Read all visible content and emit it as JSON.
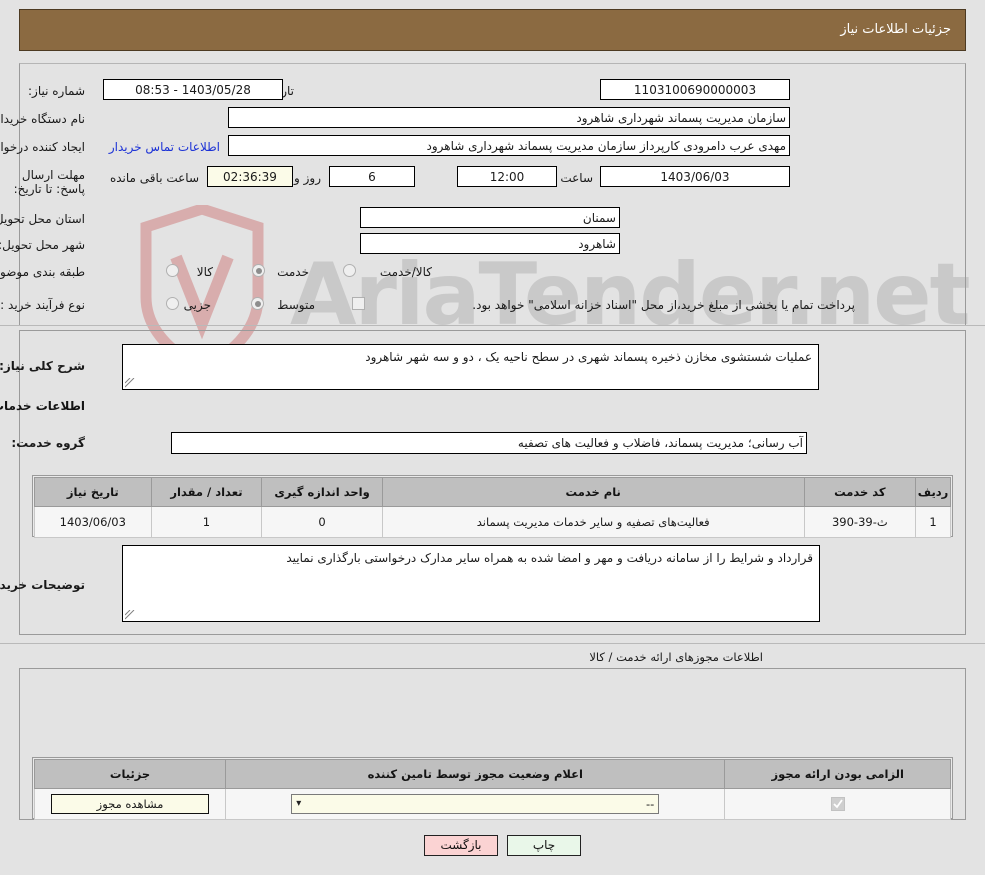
{
  "header": {
    "title": "جزئیات اطلاعات نیاز"
  },
  "watermark": {
    "text": "AriaTender.net"
  },
  "form": {
    "need_number_label": "شماره نیاز:",
    "need_number_value": "1103100690000003",
    "announce_label": "تاریخ و ساعت اعلان عمومی:",
    "announce_value": "1403/05/28 - 08:53",
    "buyer_org_label": "نام دستگاه خریدار:",
    "buyer_org_value": "سازمان مدیریت پسماند شهرداری شاهرود",
    "creator_label": "ایجاد کننده درخواست:",
    "creator_value": "مهدی عرب دامرودی کارپرداز سازمان مدیریت پسماند شهرداری شاهرود",
    "contact_link": "اطلاعات تماس خریدار",
    "deadline_label": "مهلت ارسال پاسخ: تا تاریخ:",
    "deadline_date": "1403/06/03",
    "hour_label": "ساعت",
    "hour_value": "12:00",
    "days_value": "6",
    "days_label": "روز و",
    "countdown_value": "02:36:39",
    "countdown_label": "ساعت باقی مانده",
    "province_label": "استان محل تحویل:",
    "province_value": "سمنان",
    "city_label": "شهر محل تحویل:",
    "city_value": "شاهرود",
    "category_label": "طبقه بندی موضوعی:",
    "category_options": [
      "کالا",
      "خدمت",
      "کالا/خدمت"
    ],
    "category_selected": "خدمت",
    "process_label": "نوع فرآیند خرید :",
    "process_options": [
      "جزیی",
      "متوسط"
    ],
    "process_selected": "متوسط",
    "treasury_note": "پرداخت تمام یا بخشی از مبلغ خرید،از محل \"اسناد خزانه اسلامی\" خواهد بود.",
    "treasury_checked": false
  },
  "description": {
    "need_summary_label": "شرح کلی نیاز:",
    "need_summary_value": "عملیات شستشوی مخازن ذخیره پسماند شهری در سطح ناحیه یک ، دو و سه شهر شاهرود",
    "services_heading": "اطلاعات خدمات مورد نیاز",
    "service_group_label": "گروه خدمت:",
    "service_group_value": "آب رسانی؛ مدیریت پسماند، فاضلاب و فعالیت های تصفیه",
    "buyer_notes_label": "توضیحات خریدار:",
    "buyer_notes_value": "قرارداد و شرایط را از سامانه دریافت و مهر و امضا شده به همراه سایر مدارک درخواستی بارگذاری نمایید"
  },
  "items_table": {
    "headers": [
      "ردیف",
      "کد خدمت",
      "نام خدمت",
      "واحد اندازه گیری",
      "تعداد / مقدار",
      "تاریخ نیاز"
    ],
    "rows": [
      [
        "1",
        "ث-39-390",
        "فعالیت‌های تصفیه و سایر خدمات مدیریت پسماند",
        "0",
        "1",
        "1403/06/03"
      ]
    ]
  },
  "permits": {
    "section_label": "اطلاعات مجوزهای ارائه خدمت / کالا",
    "headers": [
      "الزامی بودن ارائه مجوز",
      "اعلام وضعیت مجوز توسط تامین کننده",
      "جزئیات"
    ],
    "rows": [
      {
        "required": true,
        "status_value": "--",
        "details_button": "مشاهده مجوز"
      }
    ]
  },
  "footer": {
    "print_label": "چاپ",
    "back_label": "بازگشت"
  },
  "colors": {
    "header_bar": "#8b6a41",
    "page_background": "#e3e3e3",
    "link": "#1c32d6",
    "print_button": "#e9f7e9",
    "back_button": "#fbd3d3",
    "cream_field": "#fbfbe8",
    "table_header": "#bfbfbf"
  }
}
